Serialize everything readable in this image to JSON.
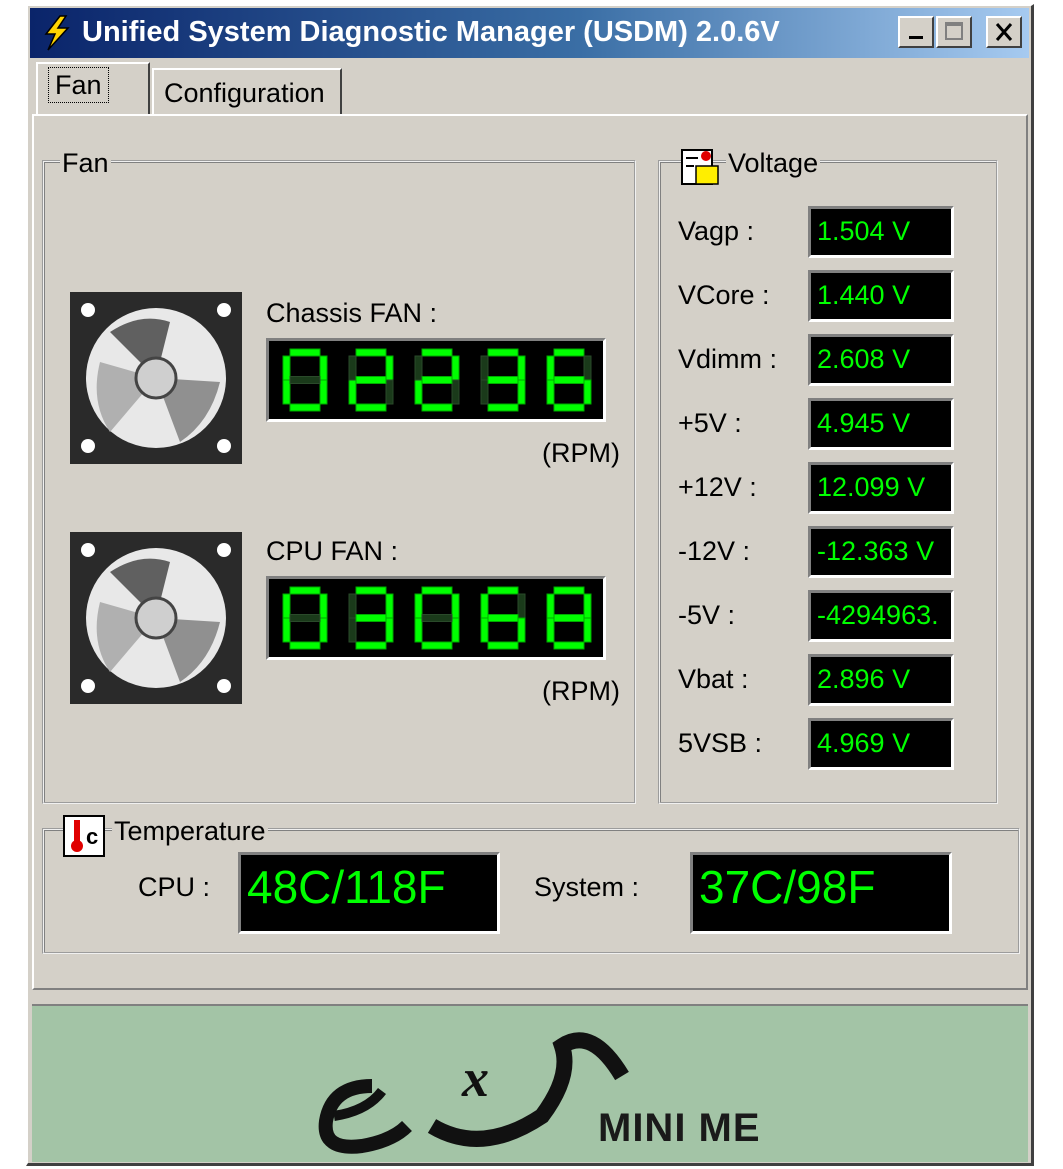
{
  "window": {
    "title": "Unified System Diagnostic Manager (USDM) 2.0.6V",
    "buttons": {
      "minimize": "minimize-icon",
      "maximize": "maximize-icon",
      "close": "close-icon"
    }
  },
  "tabs": [
    {
      "label": "Fan",
      "active": true
    },
    {
      "label": "Configuration",
      "active": false
    }
  ],
  "fan_group": {
    "legend": "Fan",
    "chassis": {
      "label": "Chassis FAN :",
      "value": "02236",
      "unit": "(RPM)"
    },
    "cpu": {
      "label": "CPU FAN :",
      "value": "03068",
      "unit": "(RPM)"
    }
  },
  "voltage_group": {
    "legend": "Voltage",
    "rows": [
      {
        "label": "Vagp :",
        "value": "1.504 V"
      },
      {
        "label": "VCore :",
        "value": "1.440 V"
      },
      {
        "label": "Vdimm :",
        "value": "2.608 V"
      },
      {
        "label": "+5V :",
        "value": "4.945 V"
      },
      {
        "label": "+12V :",
        "value": "12.099 V"
      },
      {
        "label": "-12V :",
        "value": "-12.363 V"
      },
      {
        "label": "-5V :",
        "value": "-4294963."
      },
      {
        "label": "Vbat :",
        "value": "2.896 V"
      },
      {
        "label": "5VSB :",
        "value": "4.969 V"
      }
    ]
  },
  "temperature_group": {
    "legend": "Temperature",
    "cpu_label": "CPU :",
    "cpu_value": "48C/118F",
    "system_label": "System :",
    "system_value": "37C/98F"
  },
  "footer": {
    "brand": "MINI ME"
  },
  "colors": {
    "lcd_text": "#00ff00",
    "lcd_bg": "#000000",
    "footer_bg": "#a3c4a6",
    "title_start": "#0a246a"
  }
}
